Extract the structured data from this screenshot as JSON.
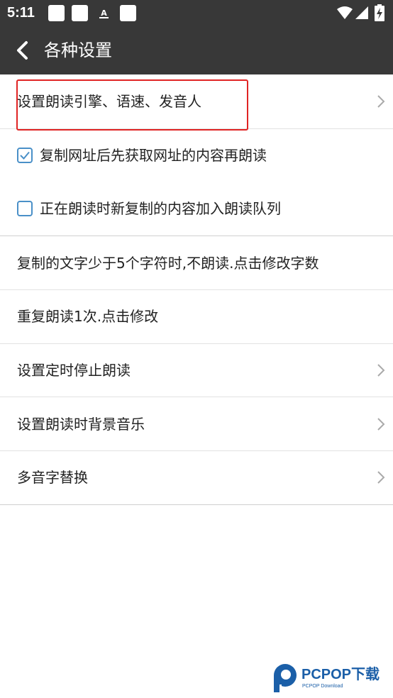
{
  "status_bar": {
    "time": "5:11",
    "notification_glyph": "A",
    "icons": [
      "notification-square-icon",
      "notification-square-icon",
      "font-a-icon",
      "notification-square-icon",
      "wifi-icon",
      "signal-icon",
      "battery-charging-icon"
    ]
  },
  "app_bar": {
    "title": "各种设置",
    "back_icon": "chevron-left-icon"
  },
  "settings": {
    "engine": {
      "label": "设置朗读引擎、语速、发音人"
    },
    "fetch_url": {
      "label": "复制网址后先获取网址的内容再朗读",
      "checked": true
    },
    "queue": {
      "label": "正在朗读时新复制的内容加入朗读队列",
      "checked": false
    },
    "min_chars": {
      "label": "复制的文字少于5个字符时,不朗读.点击修改字数"
    },
    "repeat": {
      "label": "重复朗读1次.点击修改"
    },
    "timer": {
      "label": "设置定时停止朗读"
    },
    "bg_music": {
      "label": "设置朗读时背景音乐"
    },
    "polyphone": {
      "label": "多音字替换"
    }
  },
  "watermark": {
    "brand": "PCPOP下载",
    "sub": "PCPOP Download"
  },
  "colors": {
    "app_bar": "#383838",
    "checkbox": "#4a90c8",
    "highlight": "#e02424",
    "watermark": "#1b5fa8"
  }
}
